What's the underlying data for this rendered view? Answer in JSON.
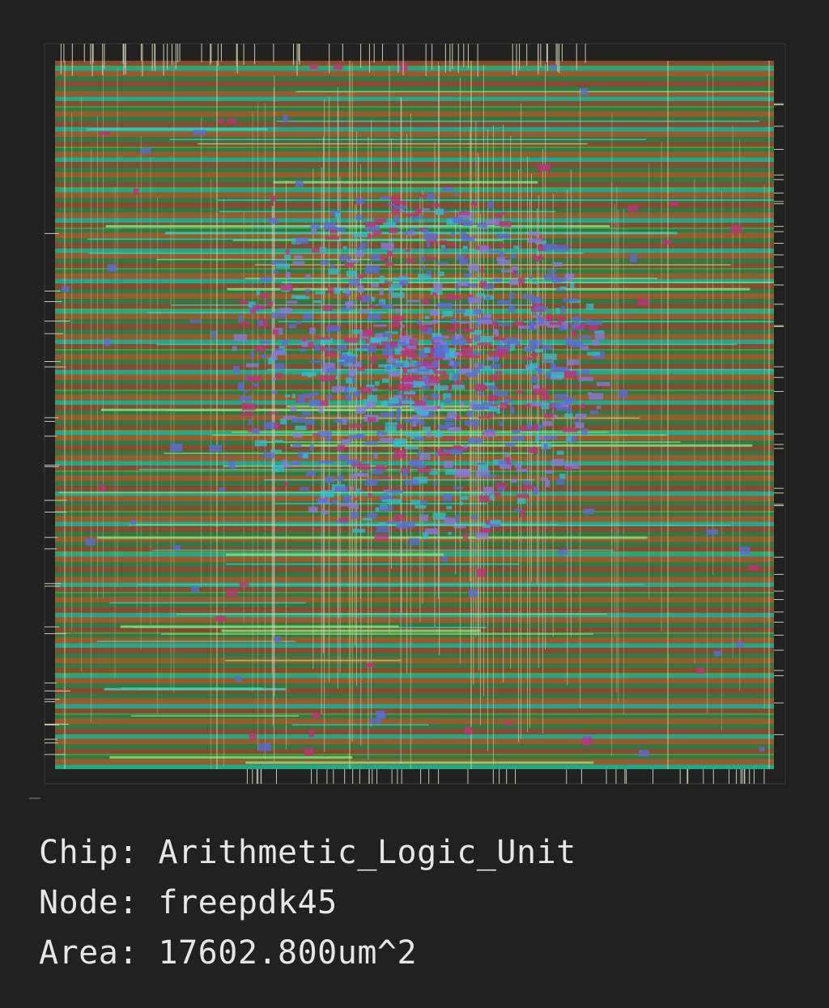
{
  "info": {
    "chip_label": "Chip:",
    "chip_value": "Arithmetic_Logic_Unit",
    "node_label": "Node:",
    "node_value": "freepdk45",
    "area_label": "Area:",
    "area_value": "17602.800um^2"
  },
  "colors": {
    "background": "#212121",
    "text": "#e6e6e6",
    "power_rail_orange": "#9a5a2a",
    "metal_green": "#3fb03f",
    "metal_teal": "#1fa88a",
    "via_magenta": "#c0307a",
    "cell_blue": "#5a6cd8",
    "route_white": "#d8d8c8",
    "die_outline": "#3c3c36"
  }
}
